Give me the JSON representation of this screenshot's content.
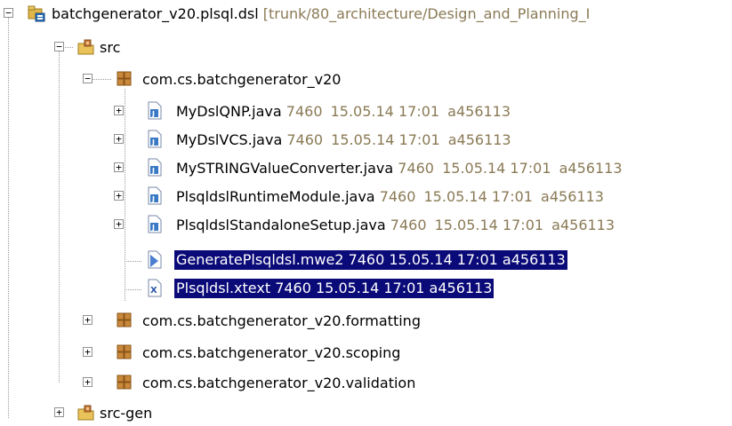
{
  "project": {
    "name": "batchgenerator_v20.plsql.dsl",
    "path": "[trunk/80_architecture/Design_and_Planning_I"
  },
  "src_label": "src",
  "package_main": "com.cs.batchgenerator_v20",
  "files": [
    {
      "name": "MyDslQNP.java",
      "rev": "7460",
      "date": "15.05.14 17:01",
      "user": "a456113"
    },
    {
      "name": "MyDslVCS.java",
      "rev": "7460",
      "date": "15.05.14 17:01",
      "user": "a456113"
    },
    {
      "name": "MySTRINGValueConverter.java",
      "rev": "7460",
      "date": "15.05.14 17:01",
      "user": "a456113"
    },
    {
      "name": "PlsqldslRuntimeModule.java",
      "rev": "7460",
      "date": "15.05.14 17:01",
      "user": "a456113"
    },
    {
      "name": "PlsqldslStandaloneSetup.java",
      "rev": "7460",
      "date": "15.05.14 17:01",
      "user": "a456113"
    }
  ],
  "selected_files": [
    {
      "text": "GeneratePlsqldsl.mwe2 7460  15.05.14 17:01  a456113"
    },
    {
      "text": "Plsqldsl.xtext 7460  15.05.14 17:01  a456113"
    }
  ],
  "packages_other": [
    "com.cs.batchgenerator_v20.formatting",
    "com.cs.batchgenerator_v20.scoping",
    "com.cs.batchgenerator_v20.validation"
  ],
  "src_gen_label": "src-gen",
  "colors": {
    "selection": "#0a0a78",
    "svn_meta": "#8a7a55"
  }
}
